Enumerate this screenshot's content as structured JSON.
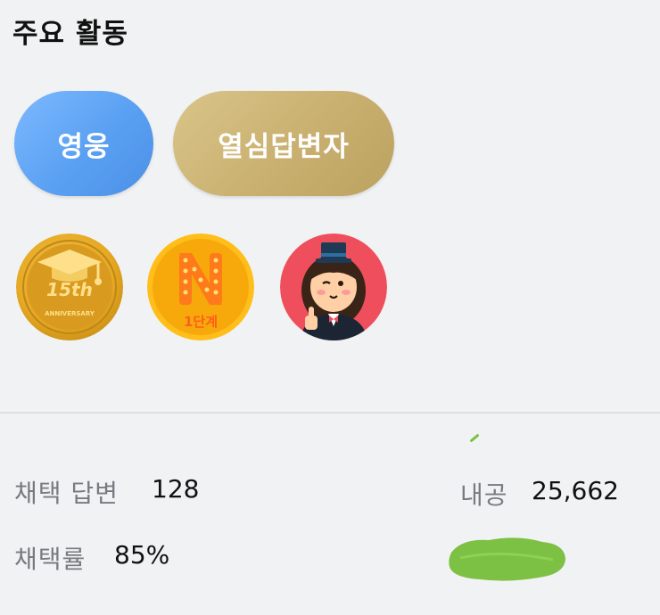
{
  "section": {
    "title": "주요 활동"
  },
  "titles": [
    {
      "label": "영웅",
      "color": "#5aa0f2"
    },
    {
      "label": "열심답변자",
      "color": "#c9b070"
    }
  ],
  "badges": [
    {
      "icon": "graduation-cap-anniversary-icon",
      "text": "15th",
      "caption": "ANNIVERSARY"
    },
    {
      "icon": "n-level-icon",
      "caption": "1단계"
    },
    {
      "icon": "top-hat-character-icon"
    }
  ],
  "stats": {
    "adopted_answers": {
      "label": "채택 답변",
      "value": "128"
    },
    "adoption_rate": {
      "label": "채택률",
      "value": "85%"
    },
    "naegong": {
      "label": "내공",
      "value": "25,662"
    }
  },
  "colors": {
    "hero_blue": "#5aa0f2",
    "gold": "#c9b070",
    "redaction_green": "#7cc144"
  }
}
